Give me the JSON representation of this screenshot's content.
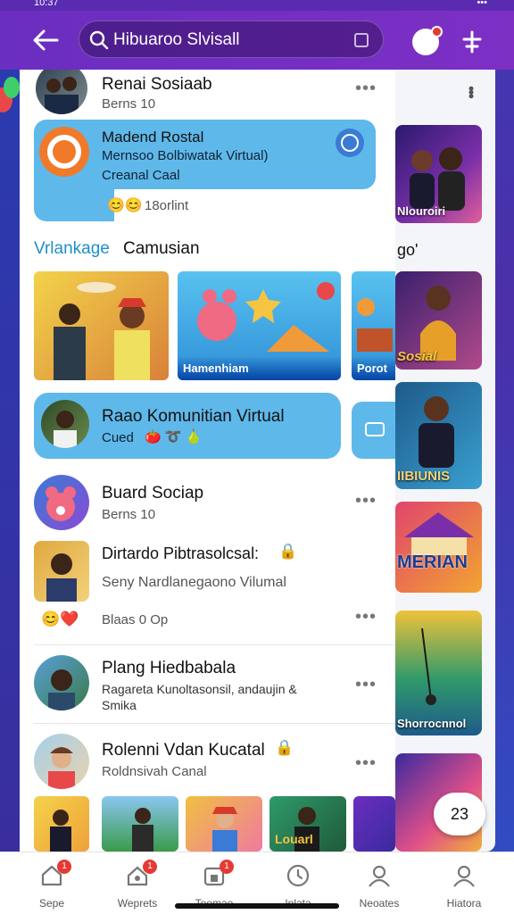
{
  "status": {
    "time": "10:37",
    "right": "•••"
  },
  "header": {
    "search_text": "Hibuaroo Slvisall",
    "back_icon": "arrow-left-icon",
    "profile_icon": "profile-icon",
    "settings_icon": "antenna-icon"
  },
  "feed": {
    "post1": {
      "name": "Renai Sosiaab",
      "sub": "Berns 10"
    },
    "card1": {
      "title": "Madend Rostal",
      "line1": "Mernsoo Bolbiwatak Virtual)",
      "line2": "Creanal Caal",
      "reactions": "18orlint"
    },
    "section_title_accent": "Vrlankage",
    "section_title": "Camusian",
    "tiles": [
      {
        "label": ""
      },
      {
        "label": "Hamenhiam"
      },
      {
        "label": "Porot"
      }
    ],
    "card2": {
      "title": "Raao Komunitian Virtual",
      "sub": "Cued"
    },
    "post2": {
      "name": "Buard Sociap",
      "sub": "Berns 10"
    },
    "post3": {
      "name": "Dirtardo Pibtrasolcsal:",
      "sub": "Seny Nardlanegaono Vilumal",
      "reactions": "Blaas 0 Op"
    },
    "post4": {
      "name": "Plang Hiedbabala",
      "line1": "Ragareta Kunoltasonsil, andaujin &",
      "line2": "Smika"
    },
    "post5": {
      "name": "Rolenni Vdan Kucatal",
      "sub": "Roldnsivah Canal"
    },
    "bottom_tiles": [
      {
        "label": ""
      },
      {
        "label": ""
      },
      {
        "label": ""
      },
      {
        "label": "Louarl"
      },
      {
        "label": ""
      }
    ]
  },
  "right_panel": {
    "card1": "Nlouroiri",
    "text": "go'",
    "card2": "Sosial",
    "card3": "IIBIUNIS",
    "card4": "MERIAN",
    "card5": "Shorrocnnol"
  },
  "fab": {
    "label": "23"
  },
  "nav": [
    {
      "label": "Sepe",
      "badge": "1",
      "icon": "home-icon"
    },
    {
      "label": "Weprets",
      "badge": "1",
      "icon": "groups-icon"
    },
    {
      "label": "Toomao",
      "badge": "1",
      "icon": "marketplace-icon"
    },
    {
      "label": "Inlata",
      "badge": "",
      "icon": "clock-icon"
    },
    {
      "label": "Neoates",
      "badge": "",
      "icon": "people-icon"
    },
    {
      "label": "Hiatora",
      "badge": "",
      "icon": "person-icon"
    }
  ],
  "colors": {
    "accent": "#6a2ec0",
    "card": "#5fb8ea",
    "badge": "#e53935"
  }
}
